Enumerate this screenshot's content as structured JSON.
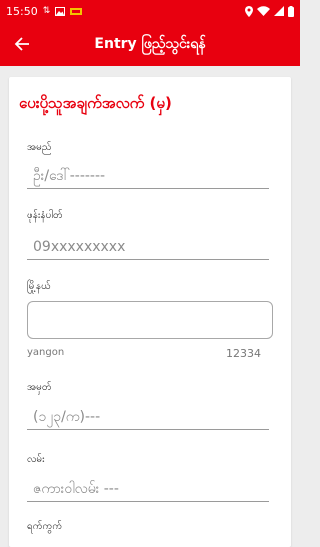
{
  "status_bar": {
    "time": "15:50",
    "left_icons": [
      "upload-arrows-icon",
      "image-icon",
      "notification-icon"
    ],
    "right_icons": [
      "location-icon",
      "wifi-icon",
      "signal-icon",
      "battery-icon"
    ]
  },
  "app_bar": {
    "title": "Entry ဖြည့်သွင်းရန်",
    "back_icon": "arrow-left-icon",
    "color": "#e8000f"
  },
  "form": {
    "section_title": "ပေးပို့သူအချက်အလက် (မှ)",
    "name": {
      "label": "အမည်",
      "placeholder": "ဦး/ဒေါ်-------"
    },
    "phone": {
      "label": "ဖုန်းနံပါတ်",
      "placeholder": "09xxxxxxxxx"
    },
    "city": {
      "label": "မြို့နယ်",
      "value": "",
      "hint_left": "yangon",
      "hint_right": "12334"
    },
    "house_no": {
      "label": "အမှတ်",
      "placeholder": "(၁၂၃/က)---"
    },
    "street": {
      "label": "လမ်း",
      "placeholder": "ဇကားဝါလမ်း ---"
    },
    "quarter": {
      "label": "ရက်ကွက်"
    }
  }
}
